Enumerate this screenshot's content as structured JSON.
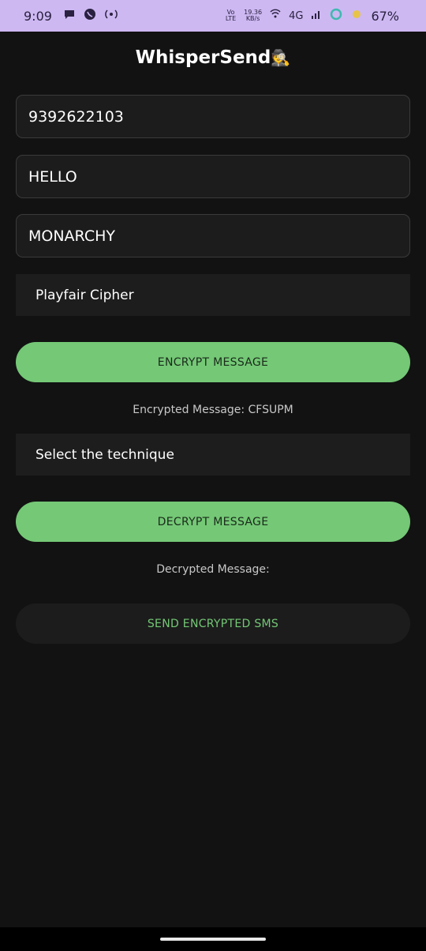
{
  "status_bar": {
    "time": "9:09",
    "network_small_1": "Vo",
    "network_small_2": "LTE",
    "speed_value": "19.36",
    "speed_unit": "KB/s",
    "network_type": "4G",
    "battery_percent": "67%",
    "bar_color": "#cdb8f2",
    "icons": [
      "chat-bubble-icon",
      "whatsapp-icon",
      "hotspot-icon",
      "hotspot-wifi-icon",
      "signal-icon",
      "ring-icon",
      "weather-icon"
    ]
  },
  "app": {
    "title": "WhisperSend",
    "title_emoji": "🕵️"
  },
  "form": {
    "phone_value": "9392622103",
    "message_value": "HELLO",
    "key_value": "MONARCHY",
    "encrypt_technique": "Playfair Cipher",
    "encrypt_button": "ENCRYPT MESSAGE",
    "encrypted_result": "Encrypted Message: CFSUPM",
    "decrypt_technique": "Select the technique",
    "decrypt_button": "DECRYPT MESSAGE",
    "decrypted_result": "Decrypted Message:",
    "send_button": "SEND ENCRYPTED SMS"
  },
  "colors": {
    "background": "#121212",
    "accent_green": "#74c876",
    "field_bg": "#1c1c1c"
  }
}
